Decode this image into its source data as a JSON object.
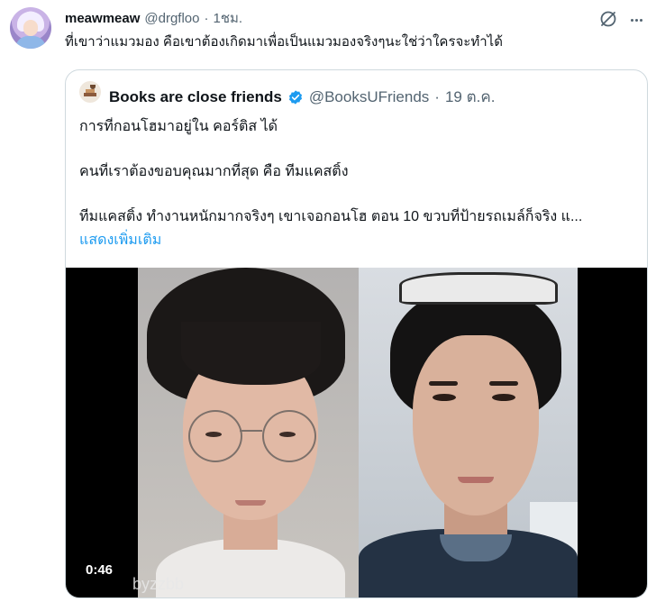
{
  "tweet": {
    "author_name": "meawmeaw",
    "author_handle": "@drgfloo",
    "separator": "·",
    "time": "1ชม.",
    "text": "ที่เขาว่าแมวมอง คือเขาต้องเกิดมาเพื่อเป็นแมวมองจริงๆนะใช่ว่าใครจะทำได้"
  },
  "quoted": {
    "author_name": "Books are close friends",
    "author_handle": "@BooksUFriends",
    "separator": "·",
    "time": "19 ต.ค.",
    "lines": [
      "การที่กอนโฮมาอยู่ใน คอร์ติส ได้",
      "คนที่เราต้องขอบคุณมากที่สุด คือ ทีมแคสติ้ง",
      "ทีมแคสติ้ง ทำงานหนักมากจริงๆ เขาเจอกอนโฮ ตอน 10 ขวบที่ป้ายรถเมล์ก็จริง แ..."
    ],
    "show_more": "แสดงเพิ่มเติม",
    "video": {
      "duration": "0:46",
      "watermark": "byzzbb"
    }
  },
  "colors": {
    "accent": "#1d9bf0",
    "secondary_text": "#536471",
    "border": "#cfd9de"
  },
  "icons": {
    "grok": "grok-icon",
    "verified": "verified-badge-icon",
    "more": "more-options-icon"
  }
}
